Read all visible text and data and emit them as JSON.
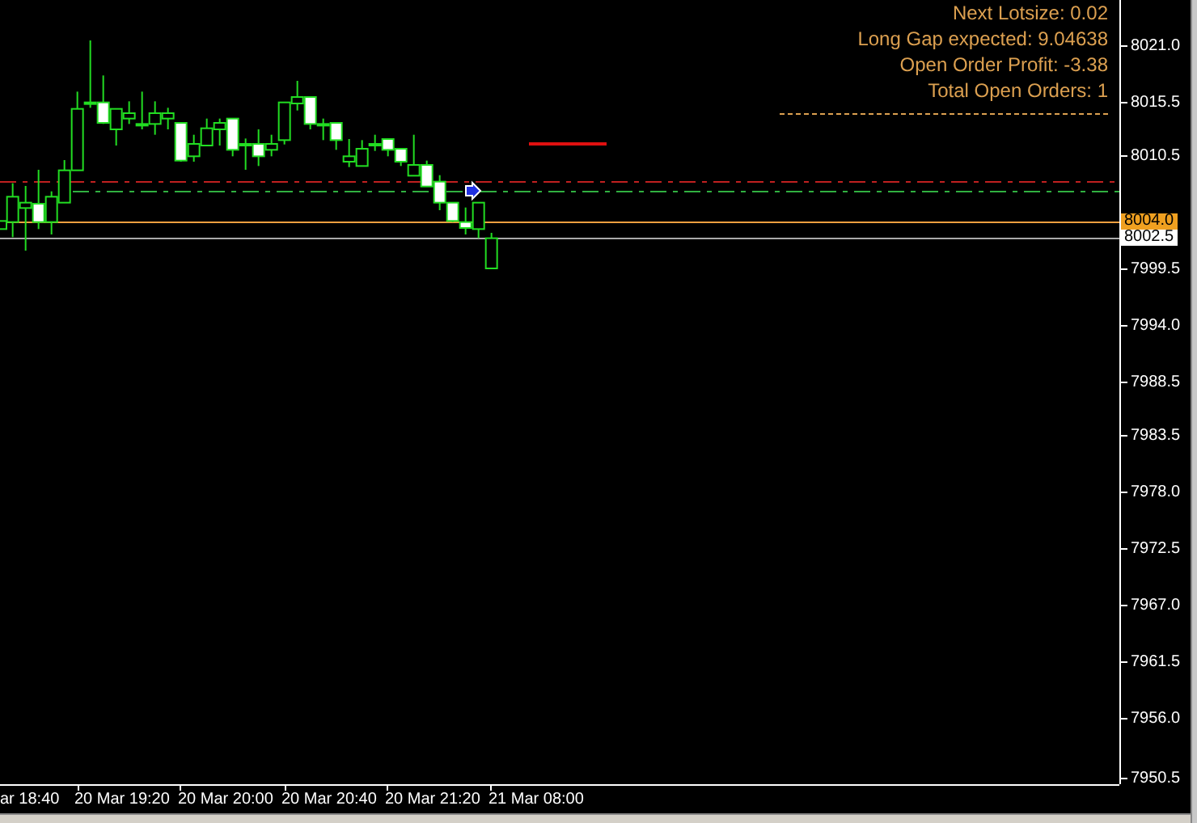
{
  "info_panel": {
    "lines": [
      "Next Lotsize: 0.02",
      "Long Gap expected: 9.04638",
      "Open Order Profit: -3.38",
      "Total Open Orders: 1"
    ]
  },
  "price_axis": {
    "ticks": [
      "8021.0",
      "8015.5",
      "8010.5",
      "7999.5",
      "7994.0",
      "7988.5",
      "7983.5",
      "7978.0",
      "7972.5",
      "7967.0",
      "7961.5",
      "7956.0",
      "7950.5"
    ],
    "markers": [
      {
        "text": "8004.0",
        "color": "#f0a020"
      },
      {
        "text": "8002.5",
        "color": "#ffffff"
      }
    ]
  },
  "time_axis": {
    "labels": [
      "ar 18:40",
      "20 Mar 19:20",
      "20 Mar 20:00",
      "20 Mar 20:40",
      "20 Mar 21:20",
      "21 Mar 08:00"
    ]
  }
}
